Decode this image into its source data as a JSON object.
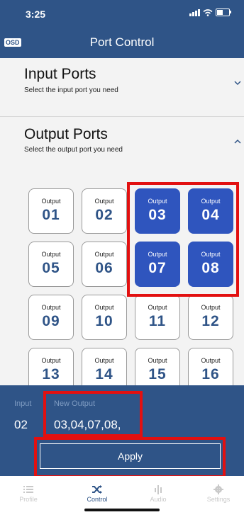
{
  "status_bar": {
    "time": "3:25"
  },
  "nav": {
    "logo": "OSD",
    "title": "Port Control"
  },
  "input_ports": {
    "title": "Input Ports",
    "subtitle": "Select the input port you need"
  },
  "output_ports": {
    "title": "Output Ports",
    "subtitle": "Select the output port you need"
  },
  "outputs": [
    {
      "label": "Output",
      "number": "01",
      "selected": false
    },
    {
      "label": "Output",
      "number": "02",
      "selected": false
    },
    {
      "label": "Output",
      "number": "03",
      "selected": true
    },
    {
      "label": "Output",
      "number": "04",
      "selected": true
    },
    {
      "label": "Output",
      "number": "05",
      "selected": false
    },
    {
      "label": "Output",
      "number": "06",
      "selected": false
    },
    {
      "label": "Output",
      "number": "07",
      "selected": true
    },
    {
      "label": "Output",
      "number": "08",
      "selected": true
    },
    {
      "label": "Output",
      "number": "09",
      "selected": false
    },
    {
      "label": "Output",
      "number": "10",
      "selected": false
    },
    {
      "label": "Output",
      "number": "11",
      "selected": false
    },
    {
      "label": "Output",
      "number": "12",
      "selected": false
    },
    {
      "label": "Output",
      "number": "13",
      "selected": false
    },
    {
      "label": "Output",
      "number": "14",
      "selected": false
    },
    {
      "label": "Output",
      "number": "15",
      "selected": false
    },
    {
      "label": "Output",
      "number": "16",
      "selected": false
    }
  ],
  "bottom_panel": {
    "input_label": "Input",
    "input_value": "02",
    "new_output_label": "New Output",
    "new_output_value": "03,04,07,08,",
    "apply_label": "Apply"
  },
  "tabs": [
    {
      "label": "Profile",
      "icon": "list-icon",
      "active": false
    },
    {
      "label": "Control",
      "icon": "shuffle-icon",
      "active": true
    },
    {
      "label": "Audio",
      "icon": "audio-bars-icon",
      "active": false
    },
    {
      "label": "Settings",
      "icon": "gear-icon",
      "active": false
    }
  ],
  "colors": {
    "brand": "#2f5487",
    "selected": "#2f55be",
    "highlight": "#e21010"
  }
}
